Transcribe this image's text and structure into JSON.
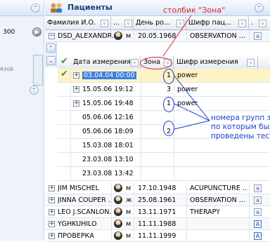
{
  "left_panel": {
    "partial_text_top": "300",
    "partial_text_mid": "кна"
  },
  "panel": {
    "title": "Пациенты",
    "columns": [
      "Фамилия И.О.",
      "...",
      "День ро...",
      "Шифр пац...",
      "."
    ],
    "expanded_patient": {
      "name": "DSD_ALEXANDR...",
      "sex": "м",
      "birth_date": "20.05.1968",
      "code": "OBSERVATION ..."
    },
    "sub_columns": [
      "Дата измерения",
      "Зона",
      "Шифр измерения"
    ],
    "measurements": [
      {
        "expander": "+",
        "checked": true,
        "date": "03.04.04 00:00",
        "zone": "1",
        "code": "power",
        "selected": true
      },
      {
        "expander": "+",
        "checked": false,
        "date": "15.05.06 19:12",
        "zone": "3",
        "code": "power",
        "selected": false
      },
      {
        "expander": "+",
        "checked": false,
        "date": "15.05.06 19:48",
        "zone": "1",
        "code": "power",
        "selected": false
      },
      {
        "expander": "",
        "checked": false,
        "date": "05.06.06 12:16",
        "zone": "",
        "code": "",
        "selected": false
      },
      {
        "expander": "",
        "checked": false,
        "date": "05.06.06 18:09",
        "zone": "2",
        "code": "",
        "selected": false
      },
      {
        "expander": "",
        "checked": false,
        "date": "15.03.08 18:01",
        "zone": "",
        "code": "",
        "selected": false
      },
      {
        "expander": "",
        "checked": false,
        "date": "23.03.08 13:10",
        "zone": "",
        "code": "",
        "selected": false
      },
      {
        "expander": "",
        "checked": false,
        "date": "23.03.08 13:42",
        "zone": "",
        "code": "",
        "selected": false
      }
    ],
    "patients": [
      {
        "name": "JIM MISCHEL",
        "sex": "м",
        "birth": "17.10.1948",
        "code": "ACUPUNCTURE ...",
        "badge": "a"
      },
      {
        "name": "JINNA COUPER ...",
        "sex": "ж",
        "birth": "25.08.1961",
        "code": "OBSERVATION ...",
        "badge": "a"
      },
      {
        "name": "LEO J.SCANLON...",
        "sex": "м",
        "birth": "13.11.1971",
        "code": "THERAPY",
        "badge": "a"
      },
      {
        "name": "YGHKUHILO",
        "sex": "м",
        "birth": "11.11.1988",
        "code": "",
        "badge": "A"
      },
      {
        "name": "ПРОВЕРКА",
        "sex": "м",
        "birth": "11.11.1999",
        "code": "",
        "badge": "A"
      }
    ]
  },
  "annotations": {
    "zone_column_label": "столбик \"Зона\"",
    "zone_groups_note": "номера групп зон,\nпо которым были\nпроведены тесты"
  },
  "colors": {
    "annotation_red": "#e0232b",
    "annotation_blue": "#1b3fd1",
    "selected_row": "#fdf3c7",
    "check_green": "#2fa12f"
  }
}
